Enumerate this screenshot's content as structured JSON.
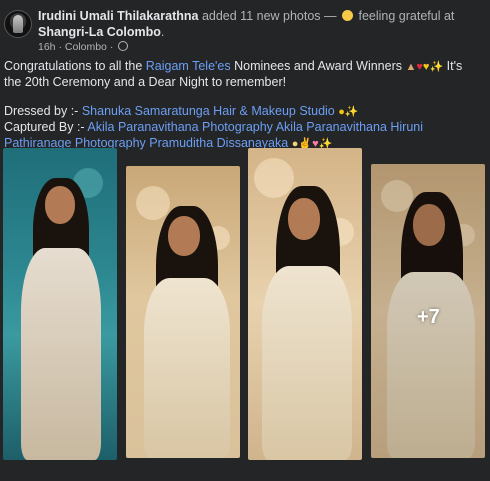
{
  "post": {
    "author": "Irudini Umali Thilakarathna",
    "action": "added 11 new photos —",
    "feeling": "feeling grateful at",
    "place": "Shangri-La Colombo",
    "place_suffix": ".",
    "time": "16h",
    "location_tag": "Colombo",
    "privacy_icon": "globe-icon"
  },
  "caption": {
    "line1_before": "Congratulations to all the",
    "line1_link": "Raigam Tele'es",
    "line1_after": "Nominees and Award Winners",
    "line1_end": "It's the 20th Ceremony and a Dear Night to remember!",
    "dressed_label": "Dressed by :-",
    "dressed_link": "Shanuka Samaratunga Hair & Makeup Studio",
    "captured_label": "Captured By :-",
    "captured_links": "Akila Paranavithana Photography Akila Paranavithana Hiruni Pathiranage Photography Pramuditha Dissanayaka"
  },
  "gallery": {
    "more_count": "+7",
    "photo_count": 4
  },
  "colors": {
    "background": "#242526",
    "text": "#e4e6eb",
    "secondary_text": "#b0b3b8",
    "link": "#6c9ff5"
  }
}
